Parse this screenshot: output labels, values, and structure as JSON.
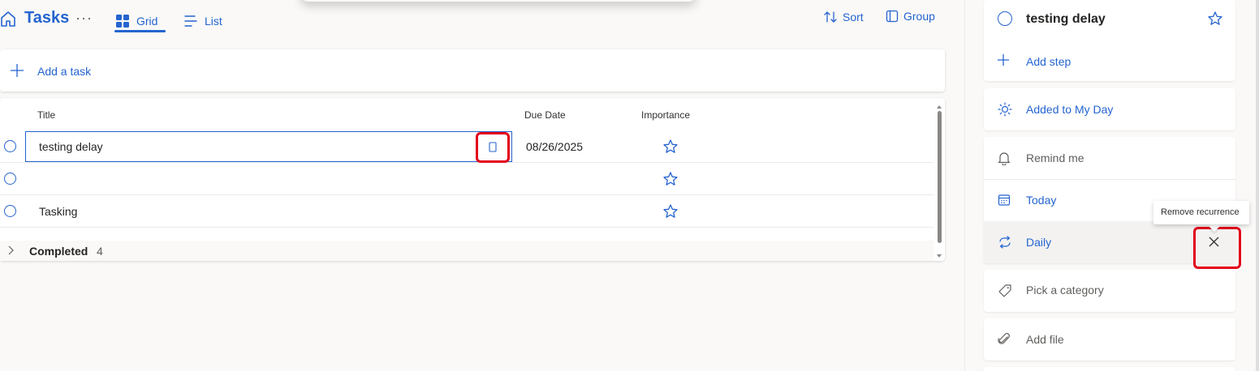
{
  "header": {
    "app_title": "Tasks",
    "more_label": "···",
    "views": [
      {
        "label": "Grid",
        "icon": "grid-icon",
        "selected": true
      },
      {
        "label": "List",
        "icon": "list-icon",
        "selected": false
      }
    ],
    "sort_label": "Sort",
    "group_label": "Group"
  },
  "add_task": {
    "label": "Add a task"
  },
  "grid": {
    "columns": [
      "Title",
      "Due Date",
      "Importance"
    ],
    "rows": [
      {
        "title": "testing delay",
        "due": "08/26/2025",
        "important": false,
        "editing": true
      },
      {
        "title": "",
        "due": "",
        "important": false
      },
      {
        "title": "Tasking",
        "due": "",
        "important": false
      }
    ],
    "completed": {
      "label": "Completed",
      "count": "4"
    }
  },
  "detail": {
    "task_title": "testing delay",
    "add_step": "Add step",
    "my_day": "Added to My Day",
    "remind": "Remind me",
    "due": "Today",
    "repeat": "Daily",
    "repeat_tooltip": "Remove recurrence",
    "category": "Pick a category",
    "file": "Add file"
  },
  "colors": {
    "accent": "#2564cf",
    "highlight": "#e3001b"
  }
}
